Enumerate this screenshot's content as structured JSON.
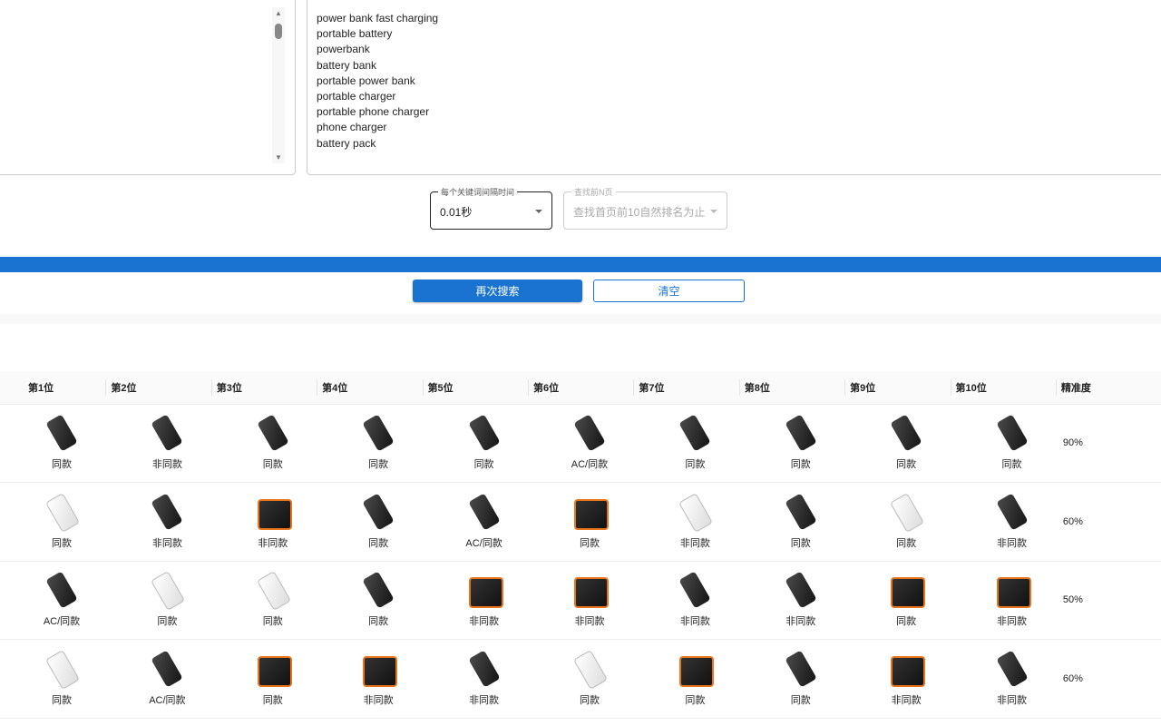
{
  "keywords": [
    "power bank fast charging",
    "portable battery",
    "powerbank",
    "battery bank",
    "portable power bank",
    "portable charger",
    "portable phone charger",
    "phone charger",
    "battery pack"
  ],
  "interval_select": {
    "label": "每个关键词间隔时间",
    "value": "0.01秒"
  },
  "pages_select": {
    "label": "查找前N页",
    "value": "查找首页前10自然排名为止",
    "disabled": true
  },
  "progress": {
    "percent": 100,
    "color": "#1a73d0"
  },
  "buttons": {
    "search_again": "再次搜索",
    "clear": "清空"
  },
  "table": {
    "headers": [
      "第1位",
      "第2位",
      "第3位",
      "第4位",
      "第5位",
      "第6位",
      "第7位",
      "第8位",
      "第9位",
      "第10位",
      "精准度"
    ],
    "rows": [
      {
        "cells": [
          "同款",
          "非同款",
          "同款",
          "同款",
          "同款",
          "AC/同款",
          "同款",
          "同款",
          "同款",
          "同款"
        ],
        "accuracy": "90%"
      },
      {
        "cells": [
          "同款",
          "非同款",
          "非同款",
          "同款",
          "AC/同款",
          "同款",
          "非同款",
          "同款",
          "同款",
          "非同款"
        ],
        "accuracy": "60%"
      },
      {
        "cells": [
          "AC/同款",
          "同款",
          "同款",
          "同款",
          "非同款",
          "非同款",
          "非同款",
          "非同款",
          "同款",
          "非同款"
        ],
        "accuracy": "50%"
      },
      {
        "cells": [
          "同款",
          "AC/同款",
          "同款",
          "非同款",
          "非同款",
          "同款",
          "同款",
          "同款",
          "非同款",
          "非同款"
        ],
        "accuracy": "60%"
      }
    ]
  }
}
